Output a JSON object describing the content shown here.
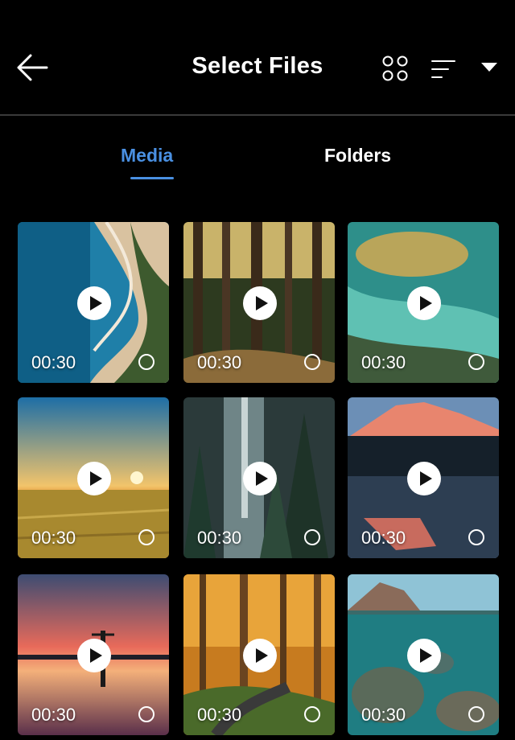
{
  "header": {
    "title": "Select Files",
    "icons": [
      "back-arrow-icon",
      "grid-view-icon",
      "sort-icon",
      "dropdown-icon"
    ]
  },
  "tabs": [
    {
      "label": "Media",
      "active": true
    },
    {
      "label": "Folders",
      "active": false
    }
  ],
  "colors": {
    "accent": "#4a90e2",
    "background": "#000000"
  },
  "media_items": [
    {
      "duration": "00:30",
      "type": "video",
      "scene": "coastline"
    },
    {
      "duration": "00:30",
      "type": "video",
      "scene": "forest"
    },
    {
      "duration": "00:30",
      "type": "video",
      "scene": "aerial-lagoon"
    },
    {
      "duration": "00:30",
      "type": "video",
      "scene": "sunset-field"
    },
    {
      "duration": "00:30",
      "type": "video",
      "scene": "waterfall-forest"
    },
    {
      "duration": "00:30",
      "type": "video",
      "scene": "mountain-lake"
    },
    {
      "duration": "00:30",
      "type": "video",
      "scene": "sunset-silhouette"
    },
    {
      "duration": "00:30",
      "type": "video",
      "scene": "autumn-forest"
    },
    {
      "duration": "00:30",
      "type": "video",
      "scene": "underwater-coast"
    }
  ]
}
